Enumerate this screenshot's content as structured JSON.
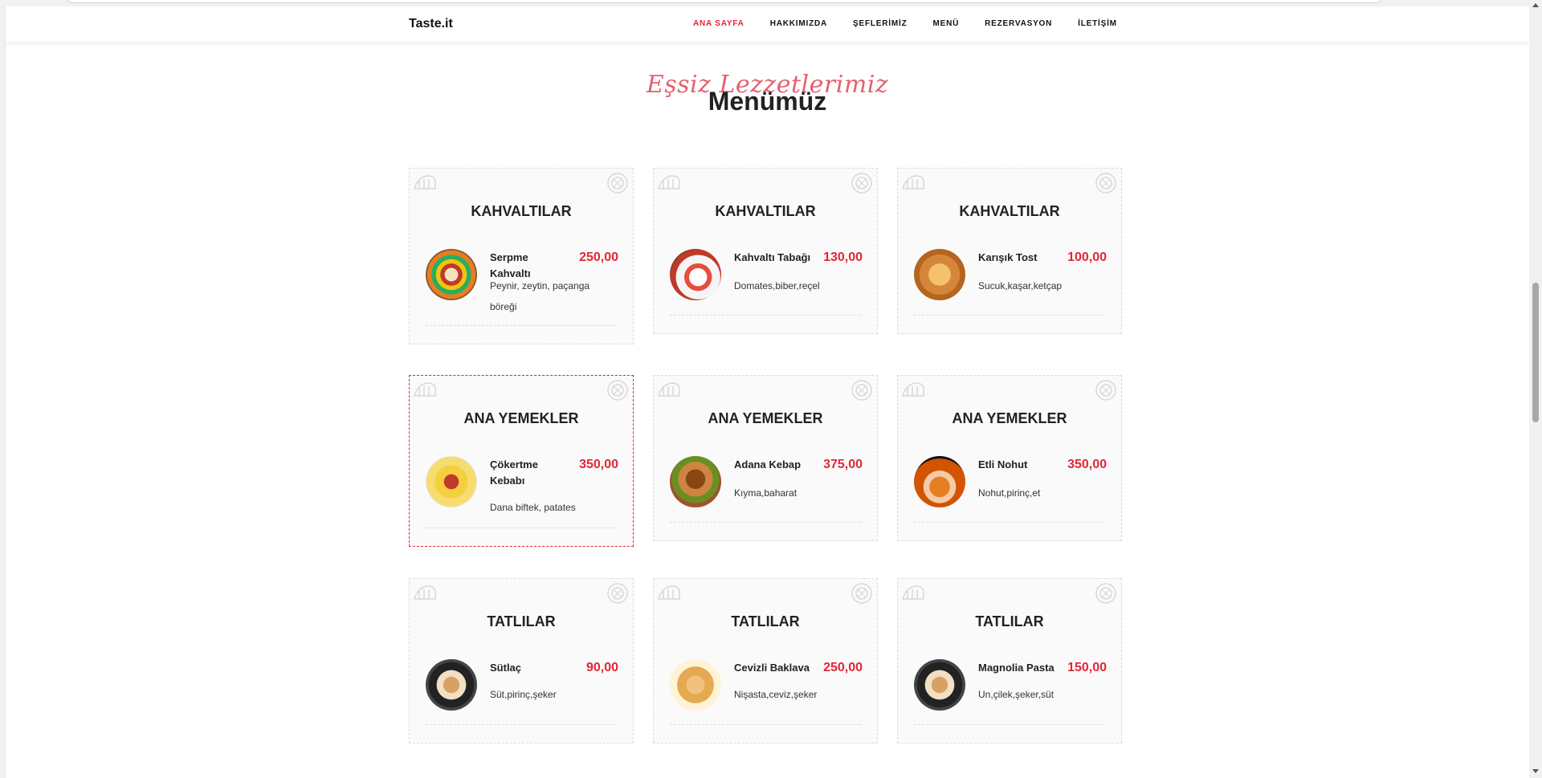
{
  "navbar": {
    "brand": "Taste.it",
    "links": [
      {
        "label": "ANA SAYFA",
        "active": true
      },
      {
        "label": "HAKKIMIZDA",
        "active": false
      },
      {
        "label": "ŞEFLERİMİZ",
        "active": false
      },
      {
        "label": "MENÜ",
        "active": false
      },
      {
        "label": "REZERVASYON",
        "active": false
      },
      {
        "label": "İLETİŞİM",
        "active": false
      }
    ]
  },
  "section": {
    "script_title": "Eşsiz Lezzetlerimiz",
    "title": "Menümüz"
  },
  "colors": {
    "accent": "#e32636",
    "script": "#e2505d",
    "card_bg": "#fafafa"
  },
  "cards": [
    {
      "category": "KAHVALTILAR",
      "name": "Serpme Kahvaltı",
      "price": "250,00",
      "desc": "Peynir, zeytin, paçanga böreği",
      "image_icon": "breakfast-spread-icon"
    },
    {
      "category": "KAHVALTILAR",
      "name": "Kahvaltı Tabağı",
      "price": "130,00",
      "desc": "Domates,biber,reçel",
      "image_icon": "breakfast-plate-icon"
    },
    {
      "category": "KAHVALTILAR",
      "name": "Karışık Tost",
      "price": "100,00",
      "desc": "Sucuk,kaşar,ketçap",
      "image_icon": "toast-icon"
    },
    {
      "category": "ANA YEMEKLER",
      "name": "Çökertme Kebabı",
      "price": "350,00",
      "desc": "Dana biftek, patates",
      "image_icon": "kebab-icon",
      "highlighted": true
    },
    {
      "category": "ANA YEMEKLER",
      "name": "Adana Kebap",
      "price": "375,00",
      "desc": "Kıyma,baharat",
      "image_icon": "adana-kebab-icon"
    },
    {
      "category": "ANA YEMEKLER",
      "name": "Etli Nohut",
      "price": "350,00",
      "desc": "Nohut,pirinç,et",
      "image_icon": "chickpea-stew-icon"
    },
    {
      "category": "TATLILAR",
      "name": "Sütlaç",
      "price": "90,00",
      "desc": "Süt,pirinç,şeker",
      "image_icon": "rice-pudding-icon"
    },
    {
      "category": "TATLILAR",
      "name": "Cevizli Baklava",
      "price": "250,00",
      "desc": "Nişasta,ceviz,şeker",
      "image_icon": "baklava-icon"
    },
    {
      "category": "TATLILAR",
      "name": "Magnolia Pasta",
      "price": "150,00",
      "desc": "Un,çilek,şeker,süt",
      "image_icon": "magnolia-dessert-icon"
    }
  ]
}
